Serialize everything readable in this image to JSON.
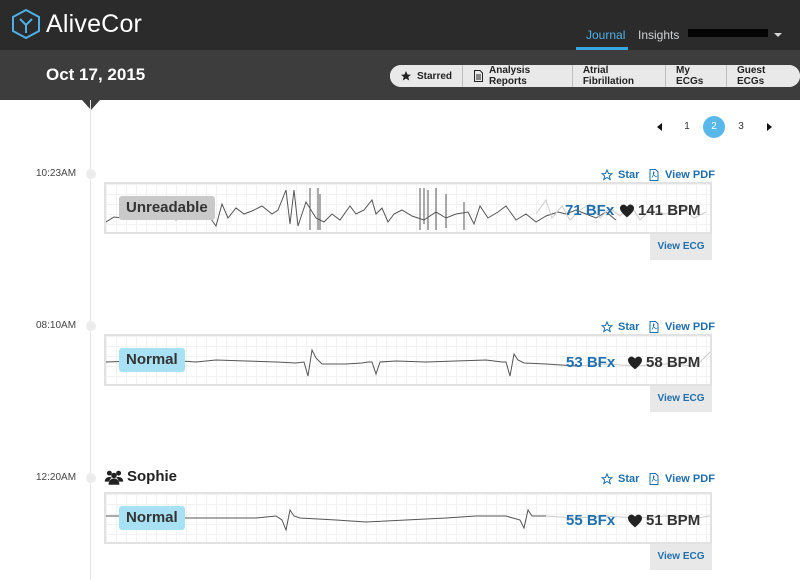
{
  "app": {
    "name": "AliveCor"
  },
  "nav": {
    "tabs": [
      {
        "label": "Journal",
        "active": true
      },
      {
        "label": "Insights",
        "active": false
      }
    ],
    "user_menu": {
      "name_redacted": true,
      "icon": "caret-down-icon"
    }
  },
  "date_bar": {
    "date": "Oct 17, 2015",
    "filters": [
      {
        "label": "Starred",
        "icon": "star-icon"
      },
      {
        "label": "Analysis Reports",
        "icon": "document-icon"
      },
      {
        "label": "Atrial Fibrillation"
      },
      {
        "label": "My ECGs"
      },
      {
        "label": "Guest ECGs"
      }
    ]
  },
  "pagination": {
    "pages": [
      "1",
      "2",
      "3"
    ],
    "current": "2"
  },
  "entries": [
    {
      "time": "10:23AM",
      "status": "Unreadable",
      "bfx": "71 BFx",
      "bpm": "141 BPM",
      "star_label": "Star",
      "pdf_label": "View PDF",
      "view_label": "View ECG"
    },
    {
      "time": "08:10AM",
      "status": "Normal",
      "bfx": "53 BFx",
      "bpm": "58 BPM",
      "star_label": "Star",
      "pdf_label": "View PDF",
      "view_label": "View ECG"
    },
    {
      "time": "12:20AM",
      "guest": "Sophie",
      "status": "Normal",
      "bfx": "55 BFx",
      "bpm": "51 BPM",
      "star_label": "Star",
      "pdf_label": "View PDF",
      "view_label": "View ECG"
    }
  ],
  "colors": {
    "topbar": "#2b2b2b",
    "datebar": "#3d3d3d",
    "accent": "#3aa6e0",
    "link": "#1f6fae",
    "normal_badge": "#a8e1f4",
    "unreadable_badge": "#c9c9c9"
  }
}
